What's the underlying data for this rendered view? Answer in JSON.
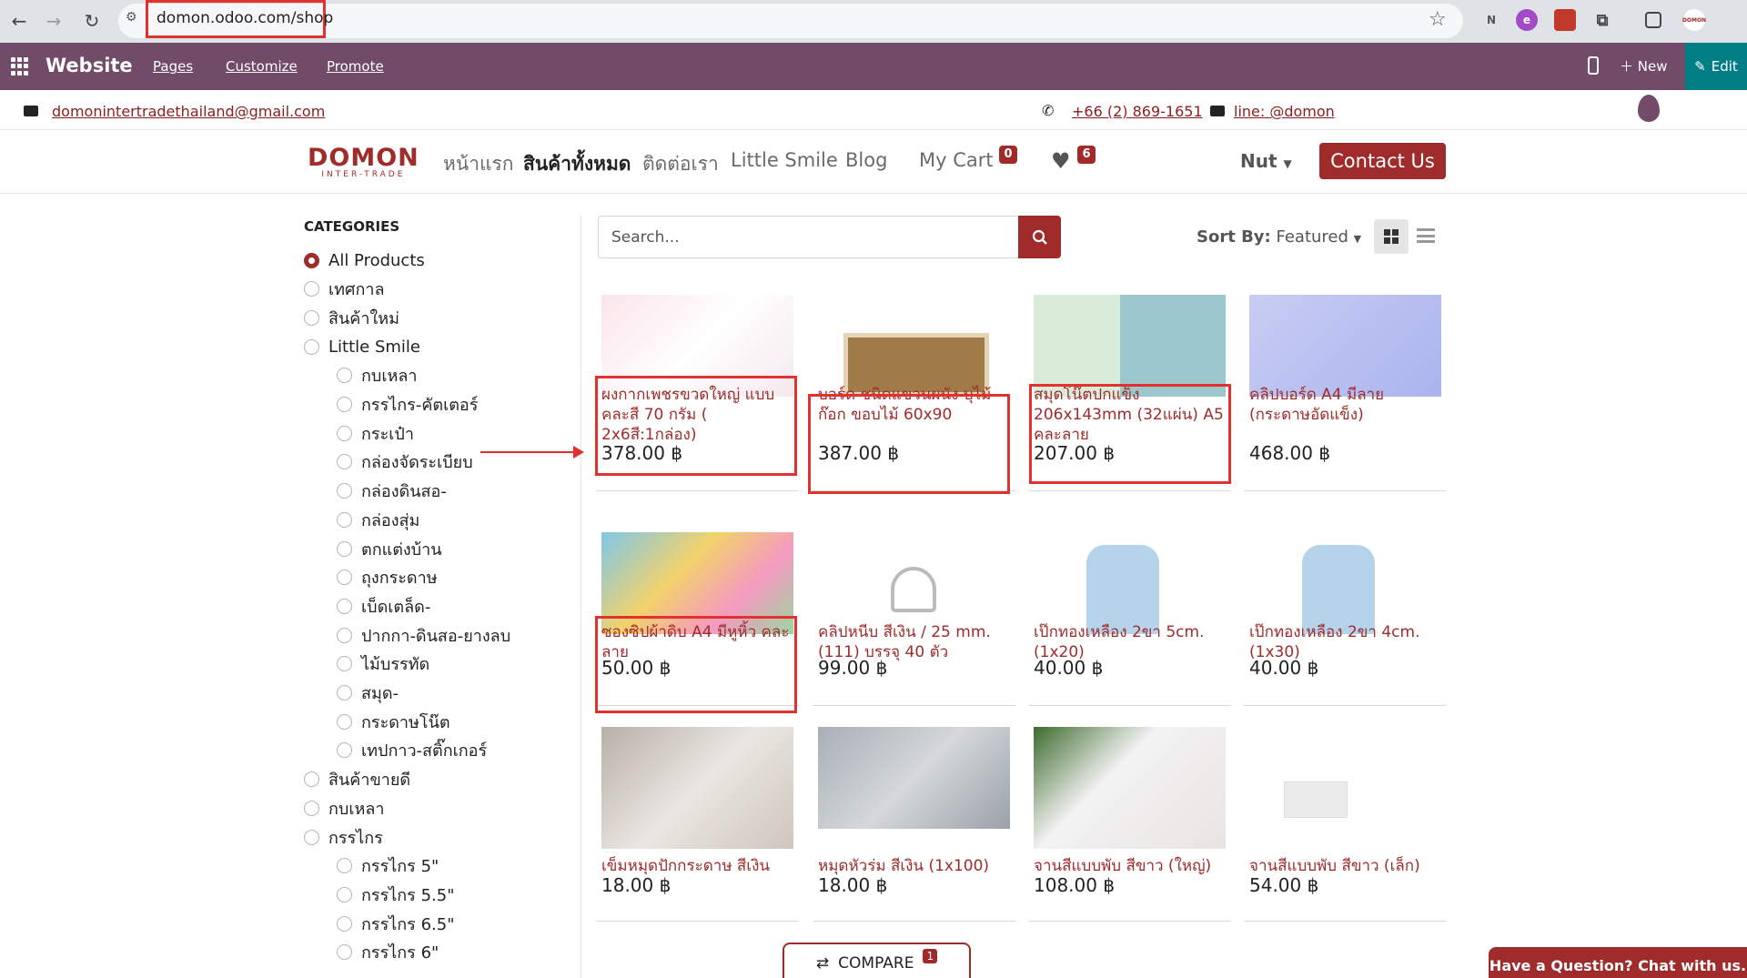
{
  "browser": {
    "url": "domon.odoo.com/shop"
  },
  "odoo_bar": {
    "title": "Website",
    "links": [
      "Pages",
      "Customize",
      "Promote"
    ],
    "new_label": "New",
    "edit_label": "Edit"
  },
  "contact_strip": {
    "email": "domonintertradethailand@gmail.com",
    "phone": "+66 (2) 869-1651",
    "line": "line: @domon"
  },
  "navbar": {
    "logo_top": "DOMON",
    "logo_bottom": "INTER-TRADE",
    "menu": [
      "หน้าแรก",
      "สินค้าทั้งหมด",
      "ติดต่อเรา",
      "Little Smile",
      "Blog"
    ],
    "cart_label": "My Cart",
    "cart_count": "0",
    "wishlist_count": "6",
    "user": "Nut",
    "contact_button": "Contact Us"
  },
  "sidebar": {
    "title": "CATEGORIES",
    "items": [
      {
        "label": "All Products",
        "checked": true,
        "level": 0
      },
      {
        "label": "เทศกาล",
        "level": 0
      },
      {
        "label": "สินค้าใหม่",
        "level": 0
      },
      {
        "label": "Little Smile",
        "level": 0
      },
      {
        "label": "กบเหลา",
        "level": 1
      },
      {
        "label": "กรรไกร-คัตเตอร์",
        "level": 1
      },
      {
        "label": "กระเป๋า",
        "level": 1
      },
      {
        "label": "กล่องจัดระเบียบ",
        "level": 1
      },
      {
        "label": "กล่องดินสอ-",
        "level": 1
      },
      {
        "label": "กล่องสุ่ม",
        "level": 1
      },
      {
        "label": "ตกแต่งบ้าน",
        "level": 1
      },
      {
        "label": "ถุงกระดาษ",
        "level": 1
      },
      {
        "label": "เบ็ดเตล็ด-",
        "level": 1
      },
      {
        "label": "ปากกา-ดินสอ-ยางลบ",
        "level": 1
      },
      {
        "label": "ไม้บรรทัด",
        "level": 1
      },
      {
        "label": "สมุด-",
        "level": 1
      },
      {
        "label": "กระดาษโน๊ต",
        "level": 1
      },
      {
        "label": "เทปกาว-สติ๊กเกอร์",
        "level": 1
      },
      {
        "label": "สินค้าขายดี",
        "level": 0
      },
      {
        "label": "กบเหลา",
        "level": 0
      },
      {
        "label": "กรรไกร",
        "level": 0
      },
      {
        "label": "กรรไกร 5\"",
        "level": 1
      },
      {
        "label": "กรรไกร 5.5\"",
        "level": 1
      },
      {
        "label": "กรรไกร 6.5\"",
        "level": 1
      },
      {
        "label": "กรรไกร 6\"",
        "level": 1
      }
    ]
  },
  "toolbar": {
    "search_placeholder": "Search...",
    "sort_label": "Sort By:",
    "sort_value": "Featured"
  },
  "products": [
    {
      "name": "ผงกากเพชรขวดใหญ่ แบบคละสี 70 กรัม ( 2x6สี:1กล่อง)",
      "price": "378.00 ฿"
    },
    {
      "name": "บอร์ด ชนิดแขวนผนัง บุไม้ก๊อก ขอบไม้ 60x90",
      "price": "387.00 ฿"
    },
    {
      "name": "สมุดโน๊ตปกแข็ง 206x143mm (32แผ่น) A5 คละลาย",
      "price": "207.00 ฿"
    },
    {
      "name": "คลิปบอร์ด A4 มีลาย (กระดาษอัดแข็ง)",
      "price": "468.00 ฿"
    },
    {
      "name": "ซองซิปผ้าดิบ A4 มีหูหิ้ว คละลาย",
      "price": "50.00 ฿"
    },
    {
      "name": "คลิปหนีบ สีเงิน / 25 mm. (111) บรรจุ 40 ตัว",
      "price": "99.00 ฿"
    },
    {
      "name": "เป๊กทองเหลือง 2ขา 5cm. (1x20)",
      "price": "40.00 ฿"
    },
    {
      "name": "เป๊กทองเหลือง 2ขา 4cm. (1x30)",
      "price": "40.00 ฿"
    },
    {
      "name": "เข็มหมุดปักกระดาษ สีเงิน",
      "price": "18.00 ฿"
    },
    {
      "name": "หมุดหัวร่ม สีเงิน (1x100)",
      "price": "18.00 ฿"
    },
    {
      "name": "จานสีแบบพับ สีขาว (ใหญ่)",
      "price": "108.00 ฿"
    },
    {
      "name": "จานสีแบบพับ สีขาว (เล็ก)",
      "price": "54.00 ฿"
    }
  ],
  "compare": {
    "label": "COMPARE",
    "count": "1"
  },
  "chat": {
    "label": "Have a Question? Chat with us."
  },
  "colors": {
    "brand": "#a02b2b",
    "odoo": "#714b67",
    "annotation": "#e3312f"
  }
}
